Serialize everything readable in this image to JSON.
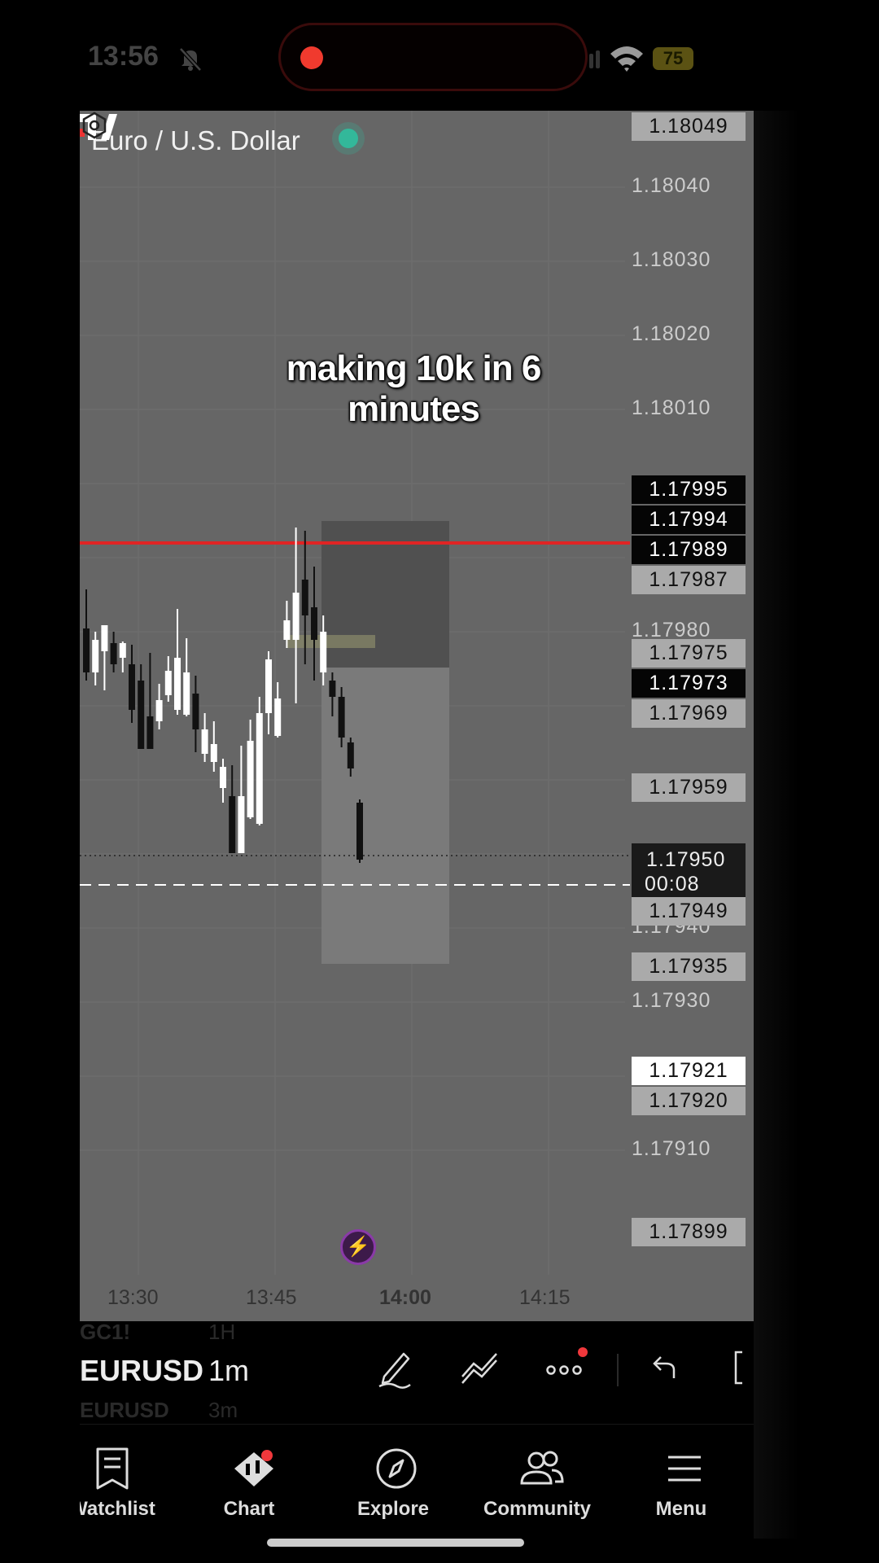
{
  "status_bar": {
    "time": "13:56",
    "battery": "75"
  },
  "chart": {
    "symbol_title": "Euro / U.S. Dollar",
    "overlay_caption": "making 10k in 6 minutes",
    "price_axis_labels": [
      "1.18040",
      "1.18030",
      "1.18020",
      "1.18010",
      "1.17980",
      "1.17940",
      "1.17930",
      "1.17910"
    ],
    "price_tags": {
      "top": "1.18049",
      "t1": "1.17995",
      "t2": "1.17994",
      "t3": "1.17989",
      "t4": "1.17987",
      "t5": "1.17975",
      "t6": "1.17973",
      "t7": "1.17969",
      "t8": "1.17959",
      "t9": "1.17949",
      "t10": "1.17935",
      "t11": "1.17921",
      "t12": "1.17920",
      "t13": "1.17899"
    },
    "current_price": "1.17950",
    "countdown": "00:08",
    "time_axis": [
      "13:30",
      "13:45",
      "14:00",
      "14:15"
    ]
  },
  "toolbar": {
    "symbol_prev": "GC1!",
    "symbol_current": "EURUSD",
    "symbol_next": "EURUSD",
    "timeframe_prev": "1H",
    "timeframe_current": "1m",
    "timeframe_next": "3m"
  },
  "nav": [
    {
      "label": "Watchlist",
      "icon": "watchlist-icon"
    },
    {
      "label": "Chart",
      "icon": "chart-icon"
    },
    {
      "label": "Explore",
      "icon": "compass-icon"
    },
    {
      "label": "Community",
      "icon": "community-icon"
    },
    {
      "label": "Menu",
      "icon": "menu-icon"
    }
  ],
  "colors": {
    "chart_bg": "#666666",
    "alert_line": "#e02424",
    "live_dot": "#33b89a",
    "record_dot": "#f03a2e",
    "bull_candle": "#ffffff",
    "bear_candle": "#111111"
  }
}
